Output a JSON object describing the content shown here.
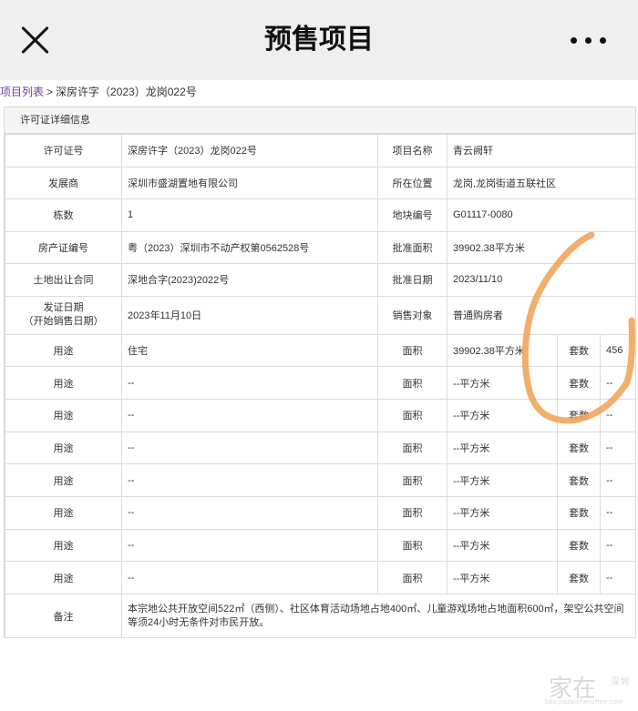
{
  "header": {
    "title": "预售项目",
    "close_icon": "close-icon",
    "more_icon": "more-horizontal-icon"
  },
  "breadcrumb": {
    "link": "项目列表",
    "separator": ">",
    "current": "深房许字（2023）龙岗022号"
  },
  "panel": {
    "title": "许可证详细信息"
  },
  "info_rows": [
    {
      "l1": "许可证号",
      "v1": "深房许字（2023）龙岗022号",
      "l2": "项目名称",
      "v2": "青云阙轩"
    },
    {
      "l1": "发展商",
      "v1": "深圳市盛湖置地有限公司",
      "l2": "所在位置",
      "v2": "龙岗,龙岗街道五联社区"
    },
    {
      "l1": "栋数",
      "v1": "1",
      "l2": "地块编号",
      "v2": "G01117-0080"
    },
    {
      "l1": "房产证编号",
      "v1": "粤（2023）深圳市不动产权第0562528号",
      "l2": "批准面积",
      "v2": "39902.38平方米"
    },
    {
      "l1": "土地出让合同",
      "v1": "深地合字(2023)2022号",
      "l2": "批准日期",
      "v2": "2023/11/10"
    }
  ],
  "issue_row": {
    "l1_line1": "发证日期",
    "l1_line2": "（开始销售日期）",
    "v1": "2023年11月10日",
    "l2": "销售对象",
    "v2": "普通购房者"
  },
  "usage_rows": [
    {
      "usage_label": "用途",
      "usage": "住宅",
      "area_label": "面积",
      "area": "39902.38平方米",
      "units_label": "套数",
      "units": "456"
    },
    {
      "usage_label": "用途",
      "usage": "--",
      "area_label": "面积",
      "area": "--平方米",
      "units_label": "套数",
      "units": "--"
    },
    {
      "usage_label": "用途",
      "usage": "--",
      "area_label": "面积",
      "area": "--平方米",
      "units_label": "套数",
      "units": "--"
    },
    {
      "usage_label": "用途",
      "usage": "--",
      "area_label": "面积",
      "area": "--平方米",
      "units_label": "套数",
      "units": "--"
    },
    {
      "usage_label": "用途",
      "usage": "--",
      "area_label": "面积",
      "area": "--平方米",
      "units_label": "套数",
      "units": "--"
    },
    {
      "usage_label": "用途",
      "usage": "--",
      "area_label": "面积",
      "area": "--平方米",
      "units_label": "套数",
      "units": "--"
    },
    {
      "usage_label": "用途",
      "usage": "--",
      "area_label": "面积",
      "area": "--平方米",
      "units_label": "套数",
      "units": "--"
    },
    {
      "usage_label": "用途",
      "usage": "--",
      "area_label": "面积",
      "area": "--平方米",
      "units_label": "套数",
      "units": "--"
    }
  ],
  "remark": {
    "label": "备注",
    "text": "本宗地公共开放空间522㎡（西侧）、社区体育活动场地占地400㎡、儿童游戏场地占地面积600㎡，架空公共空间等须24小时无条件对市民开放。"
  },
  "watermark": {
    "main": "家在",
    "side": "深圳",
    "url": "bbs.jiazaishenzhen.com"
  },
  "colors": {
    "topbar_bg": "#efeff0",
    "link": "#6b3fa0",
    "border": "#dcdcdc",
    "scribble": "#f0a356"
  }
}
